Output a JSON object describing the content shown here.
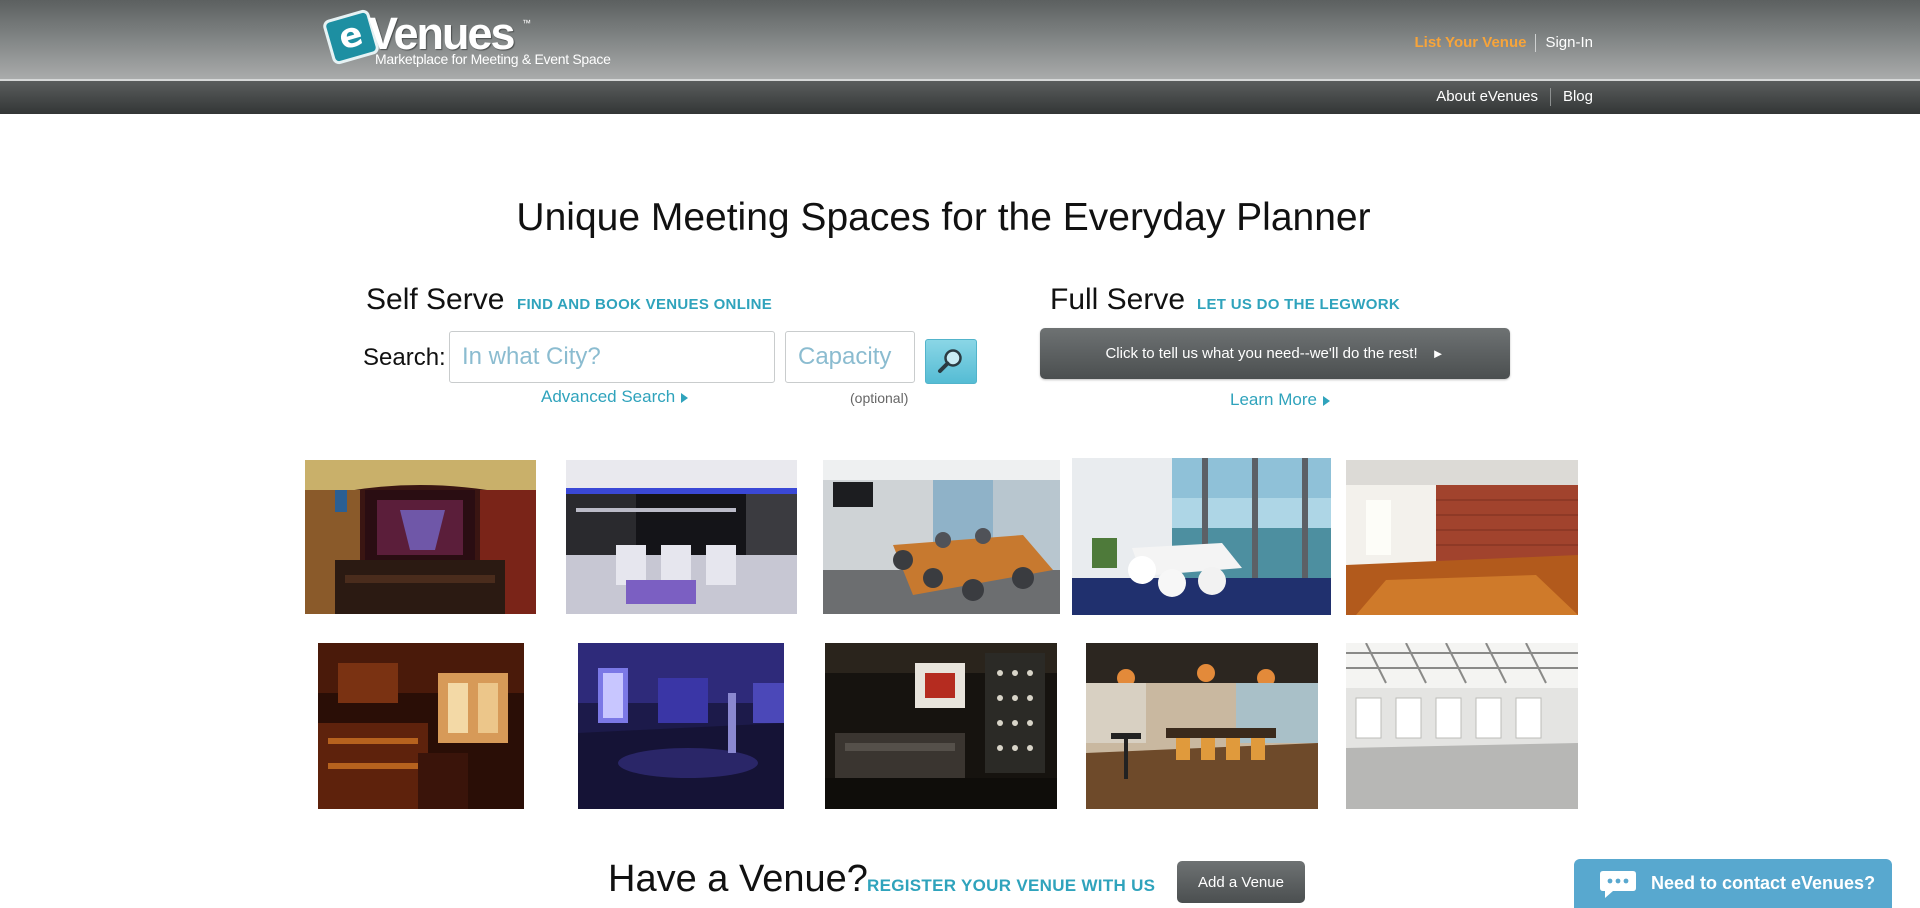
{
  "brand": {
    "logo_letter": "e",
    "logo_word": "Venues",
    "trademark": "™",
    "tagline": "Marketplace for Meeting & Event Space",
    "accent_color": "#2fa3bc",
    "orange_color": "#f7a43a"
  },
  "header": {
    "list_venue": "List Your Venue",
    "sign_in": "Sign-In",
    "about": "About eVenues",
    "blog": "Blog"
  },
  "hero": {
    "headline": "Unique Meeting Spaces for the Everyday Planner"
  },
  "self_serve": {
    "title": "Self Serve",
    "subtitle": "FIND AND BOOK VENUES ONLINE",
    "search_label": "Search:",
    "city_placeholder": "In what City?",
    "city_value": "",
    "capacity_placeholder": "Capacity",
    "capacity_value": "",
    "search_icon": "magnifier-icon",
    "advanced_search": "Advanced Search",
    "optional_note": "(optional)"
  },
  "full_serve": {
    "title": "Full Serve",
    "subtitle": "LET US DO THE LEGWORK",
    "cta": "Click to tell us what you need--we'll do the rest!",
    "cta_arrow": "►",
    "learn_more": "Learn More"
  },
  "venues": [
    {
      "name": "venue-theater"
    },
    {
      "name": "venue-lounge-blue"
    },
    {
      "name": "venue-conference-room"
    },
    {
      "name": "venue-ocean-view-room"
    },
    {
      "name": "venue-brick-loft"
    },
    {
      "name": "venue-wood-bar"
    },
    {
      "name": "venue-blue-hall"
    },
    {
      "name": "venue-wine-lounge"
    },
    {
      "name": "venue-cafe-tables"
    },
    {
      "name": "venue-white-hall"
    }
  ],
  "bottom": {
    "have_venue": "Have a Venue?",
    "register": "REGISTER YOUR VENUE WITH US",
    "add_venue": "Add a Venue"
  },
  "contact": {
    "label": "Need to contact eVenues?",
    "icon": "chat-bubble-icon",
    "color": "#58a8cf"
  }
}
